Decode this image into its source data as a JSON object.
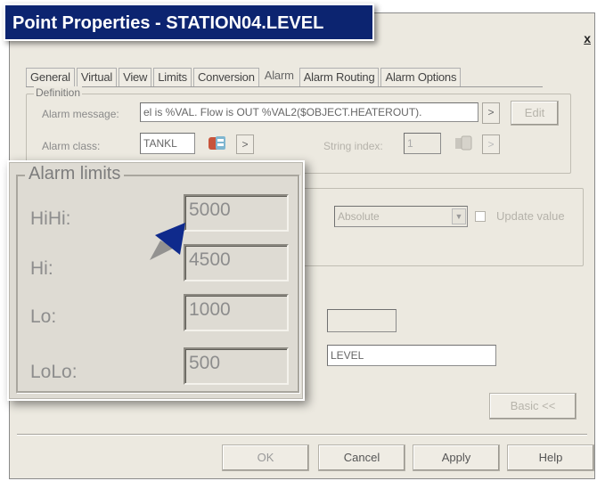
{
  "window": {
    "title": "Point Properties - STATION04.LEVEL",
    "close_glyph": "x"
  },
  "tabs": [
    {
      "label": "General",
      "active": false
    },
    {
      "label": "Virtual",
      "active": false
    },
    {
      "label": "View",
      "active": false
    },
    {
      "label": "Limits",
      "active": false
    },
    {
      "label": "Conversion",
      "active": false
    },
    {
      "label": "Alarm",
      "active": true
    },
    {
      "label": "Alarm Routing",
      "active": false
    },
    {
      "label": "Alarm Options",
      "active": false
    }
  ],
  "definition": {
    "legend": "Definition",
    "alarm_message_label": "Alarm message:",
    "alarm_message_value": "el is %VAL. Flow is OUT %VAL2($OBJECT.HEATEROUT).",
    "arrow_btn": ">",
    "edit_btn": "Edit",
    "alarm_class_label": "Alarm class:",
    "alarm_class_value": "TANKL",
    "string_index_label": "String index:",
    "string_index_value": "1"
  },
  "deadband": {
    "select_value": "Absolute",
    "update_value_label": "Update value"
  },
  "lower": {
    "blank_field": "",
    "level_value": "LEVEL",
    "basic_btn": "Basic <<"
  },
  "footer": {
    "ok": "OK",
    "cancel": "Cancel",
    "apply": "Apply",
    "help": "Help"
  },
  "alarm_limits": {
    "legend": "Alarm limits",
    "hihi_label": "HiHi:",
    "hihi_value": "5000",
    "hi_label": "Hi:",
    "hi_value": "4500",
    "lo_label": "Lo:",
    "lo_value": "1000",
    "lolo_label": "LoLo:",
    "lolo_value": "500"
  },
  "colors": {
    "title_banner_bg": "#0c2470",
    "dialog_bg": "#ece9e0",
    "pointer_blue": "#0f2a8c"
  }
}
